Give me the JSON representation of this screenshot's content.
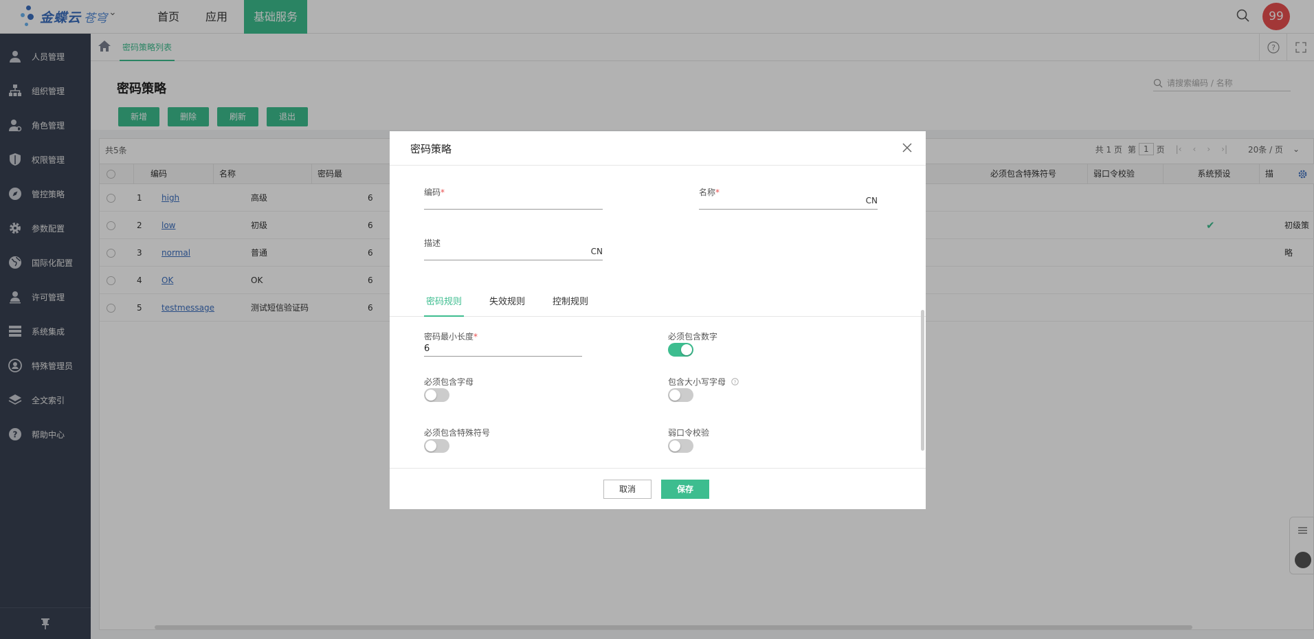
{
  "header": {
    "logo_text": "金蝶云",
    "logo_sub": "苍穹",
    "nav": [
      "首页",
      "应用",
      "基础服务"
    ],
    "avatar_text": "99"
  },
  "sidebar": {
    "items": [
      {
        "label": "人员管理",
        "icon": "person-icon"
      },
      {
        "label": "组织管理",
        "icon": "org-icon"
      },
      {
        "label": "角色管理",
        "icon": "role-icon"
      },
      {
        "label": "权限管理",
        "icon": "shield-icon"
      },
      {
        "label": "管控策略",
        "icon": "compass-icon"
      },
      {
        "label": "参数配置",
        "icon": "gear-icon"
      },
      {
        "label": "国际化配置",
        "icon": "globe-icon"
      },
      {
        "label": "许可管理",
        "icon": "license-icon"
      },
      {
        "label": "系统集成",
        "icon": "server-icon"
      },
      {
        "label": "特殊管理员",
        "icon": "admin-icon"
      },
      {
        "label": "全文索引",
        "icon": "layers-icon"
      },
      {
        "label": "帮助中心",
        "icon": "help-icon"
      }
    ]
  },
  "tabs": {
    "active": "密码策略列表"
  },
  "page": {
    "title": "密码策略",
    "buttons": [
      "新增",
      "删除",
      "刷新",
      "退出"
    ],
    "search_placeholder": "请搜索编码 / 名称"
  },
  "grid": {
    "total": "共5条",
    "pager": {
      "total_pages": "共 1 页",
      "page_prefix": "第",
      "page": "1",
      "page_suffix": "页",
      "page_size": "20条 / 页"
    },
    "columns": [
      "编码",
      "名称",
      "密码最",
      "必须包含特殊符号",
      "弱口令校验",
      "系统预设",
      "描"
    ],
    "rows": [
      {
        "no": "1",
        "code": "high",
        "name": "高级",
        "minlen": "6",
        "preset": false,
        "desc": ""
      },
      {
        "no": "2",
        "code": "low",
        "name": "初级",
        "minlen": "6",
        "preset": true,
        "desc": "初级策略"
      },
      {
        "no": "3",
        "code": "normal",
        "name": "普通",
        "minlen": "6",
        "preset": false,
        "desc": ""
      },
      {
        "no": "4",
        "code": "OK",
        "name": "OK",
        "minlen": "6",
        "preset": false,
        "desc": ""
      },
      {
        "no": "5",
        "code": "testmessage",
        "name": "测试短信验证码",
        "minlen": "6",
        "preset": false,
        "desc": ""
      }
    ]
  },
  "modal": {
    "title": "密码策略",
    "code_label": "编码",
    "name_label": "名称",
    "name_lang": "CN",
    "desc_label": "描述",
    "desc_lang": "CN",
    "tabs": [
      "密码规则",
      "失效规则",
      "控制规则"
    ],
    "min_length_label": "密码最小长度",
    "min_length_value": "6",
    "must_digit_label": "必须包含数字",
    "must_digit_on": true,
    "must_letter_label": "必须包含字母",
    "must_letter_on": false,
    "case_label": "包含大小写字母",
    "case_on": false,
    "special_label": "必须包含特殊符号",
    "special_on": false,
    "weak_label": "弱口令校验",
    "weak_on": false,
    "cancel": "取消",
    "save": "保存"
  },
  "colors": {
    "accent": "#3dbd8f",
    "sidebar": "#394152",
    "avatar": "#e94f4f",
    "link": "#3c6fbf"
  }
}
